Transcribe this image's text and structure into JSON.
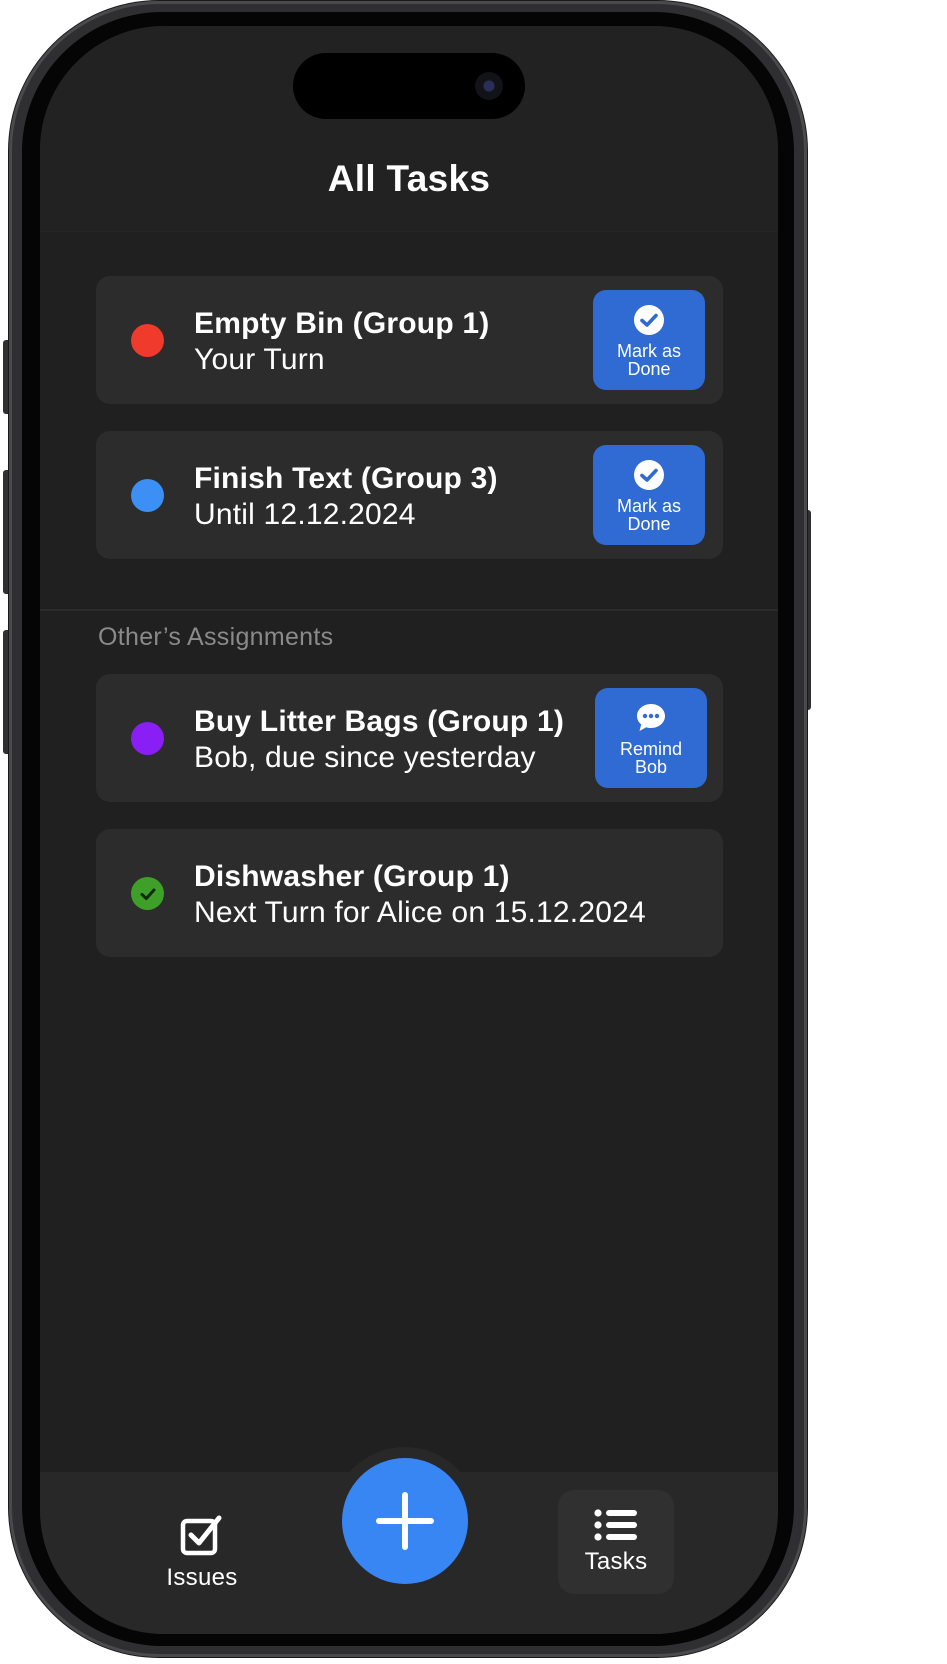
{
  "header": {
    "title": "All Tasks"
  },
  "my_tasks": [
    {
      "title": "Empty Bin (Group 1)",
      "subtitle": "Your Turn",
      "status_color": "#ef3a2c",
      "action_label": "Mark as Done",
      "action_icon": "check-circle-icon"
    },
    {
      "title": "Finish Text (Group 3)",
      "subtitle": "Until 12.12.2024",
      "status_color": "#3b8ff5",
      "action_label": "Mark as Done",
      "action_icon": "check-circle-icon"
    }
  ],
  "others_section": {
    "label": "Other’s Assignments"
  },
  "other_tasks": [
    {
      "title": "Buy Litter Bags (Group 1)",
      "subtitle": "Bob, due since yesterday",
      "status_color": "#8a1ff5",
      "action_label": "Remind Bob",
      "action_icon": "chat-bubble-icon"
    },
    {
      "title": "Dishwasher (Group 1)",
      "subtitle": "Next Turn for Alice on 15.12.2024",
      "status_color": "#3ea028",
      "status_icon": "check-circle-icon"
    }
  ],
  "bottom_nav": {
    "issues_label": "Issues",
    "tasks_label": "Tasks",
    "fab_icon": "plus-icon"
  },
  "colors": {
    "background": "#202020",
    "card": "#2c2c2c",
    "action_button": "#2f6bd2",
    "fab": "#3886f4"
  }
}
